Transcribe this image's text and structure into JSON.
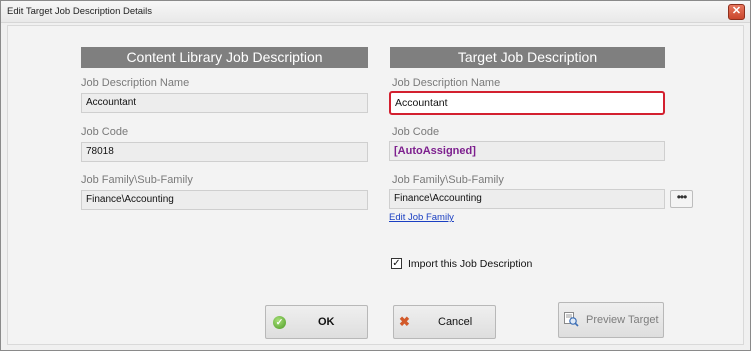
{
  "window": {
    "title": "Edit Target Job Description Details",
    "close_symbol": "✕"
  },
  "left": {
    "header": "Content Library Job Description",
    "job_name_label": "Job Description Name",
    "job_name_value": "Accountant",
    "job_code_label": "Job Code",
    "job_code_value": "78018",
    "job_family_label": "Job Family\\Sub-Family",
    "job_family_value": "Finance\\Accounting"
  },
  "right": {
    "header": "Target Job Description",
    "job_name_label": "Job Description Name",
    "job_name_value": "Accountant",
    "job_code_label": "Job Code",
    "job_code_value": "[AutoAssigned]",
    "job_family_label": "Job Family\\Sub-Family",
    "job_family_value": "Finance\\Accounting",
    "browse_button": "•••",
    "edit_link": "Edit Job Family",
    "import_checkbox_label": "Import this Job Description",
    "import_checked": true,
    "check_mark": "✓"
  },
  "buttons": {
    "ok": "OK",
    "ok_icon_glyph": "✓",
    "cancel": "Cancel",
    "cancel_icon_glyph": "✖",
    "preview": "Preview Target"
  },
  "colors": {
    "header_bg": "#7f7f7f",
    "focus_border": "#d3202f",
    "auto_assigned": "#7d1f8e",
    "link": "#1a3fc2"
  }
}
